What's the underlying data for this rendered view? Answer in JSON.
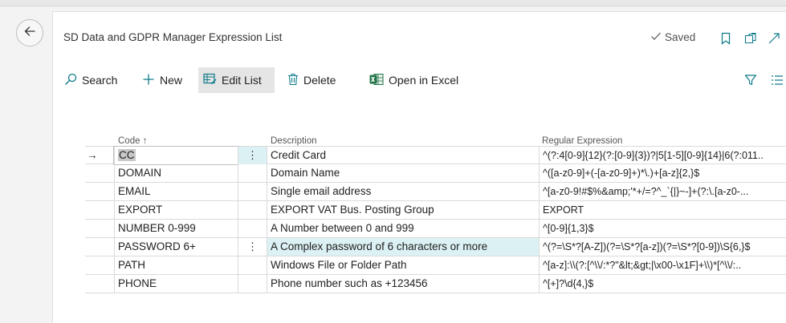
{
  "page": {
    "title": "SD Data and GDPR Manager Expression List",
    "saved_label": "Saved"
  },
  "icons": {
    "back": "back-arrow-icon",
    "bookmark": "bookmark-icon",
    "open_new_window": "open-new-window-icon",
    "expand": "expand-icon",
    "filter": "filter-icon",
    "list_view": "list-view-icon"
  },
  "colors": {
    "accent": "#0f7b8a",
    "excel_green": "#217346",
    "selected_row": "#dcf1f3",
    "edit_list_active": "#e5e5e5"
  },
  "actions": {
    "search": "Search",
    "new": "New",
    "edit_list": "Edit List",
    "delete": "Delete",
    "open_in_excel": "Open in Excel"
  },
  "table": {
    "columns": {
      "code": "Code ↑",
      "description": "Description",
      "regex": "Regular Expression"
    },
    "rows": [
      {
        "arrow": "→",
        "code": "CC",
        "dots": "⋮",
        "description": "Credit Card",
        "regex": "^(?:4[0-9]{12}(?:[0-9]{3})?|5[1-5][0-9]{14}|6(?:011.."
      },
      {
        "arrow": "",
        "code": "DOMAIN",
        "dots": "",
        "description": "Domain Name",
        "regex": "^([a-z0-9]+(-[a-z0-9]+)*\\.)+[a-z]{2,}$"
      },
      {
        "arrow": "",
        "code": "EMAIL",
        "dots": "",
        "description": "Single email address",
        "regex": "^[a-z0-9!#$%&amp;'*+/=?^_`{|}~-]+(?:\\.[a-z0-..."
      },
      {
        "arrow": "",
        "code": "EXPORT",
        "dots": "",
        "description": "EXPORT VAT Bus. Posting Group",
        "regex": "EXPORT"
      },
      {
        "arrow": "",
        "code": "NUMBER 0-999",
        "dots": "",
        "description": "A Number between 0 and 999",
        "regex": "^[0-9]{1,3}$"
      },
      {
        "arrow": "",
        "code": "PASSWORD 6+",
        "dots": "⋮",
        "description": "A Complex password of 6 characters or more",
        "regex": "^(?=\\S*?[A-Z])(?=\\S*?[a-z])(?=\\S*?[0-9])\\S{6,}$"
      },
      {
        "arrow": "",
        "code": "PATH",
        "dots": "",
        "description": "Windows File or Folder Path",
        "regex": "^[a-z]:\\\\(?:[^\\\\/:*?\"&lt;&gt;|\\x00-\\x1F]+\\\\)*[^\\\\/:.."
      },
      {
        "arrow": "",
        "code": "PHONE",
        "dots": "",
        "description": "Phone number such as +123456",
        "regex": "^[+]?\\d{4,}$"
      }
    ]
  }
}
